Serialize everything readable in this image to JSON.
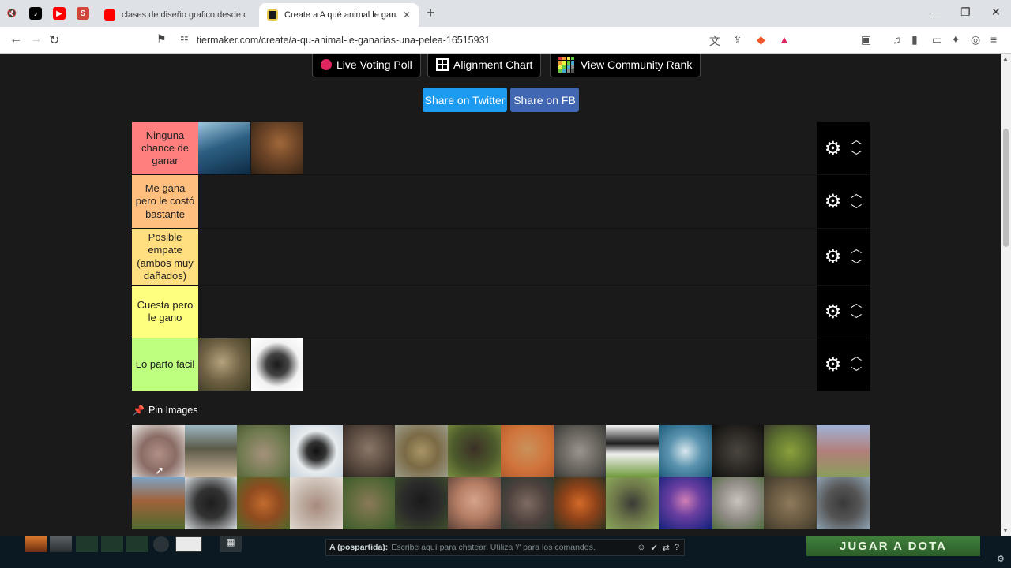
{
  "browser": {
    "tabs": [
      {
        "title": "clases de diseño grafico desde cero -",
        "favicon_color": "#ff0000"
      },
      {
        "title": "Create a A qué animal le ganarías",
        "favicon_color": "#1a1a1a",
        "active": true
      }
    ],
    "pinned_tabs": [
      {
        "icon": "mute-icon",
        "color": "#555555"
      },
      {
        "icon": "tiktok-icon",
        "color": "#000000"
      },
      {
        "icon": "youtube-icon",
        "color": "#ff0000"
      },
      {
        "icon": "s-icon",
        "color": "#d0443a"
      }
    ],
    "url": "tiermaker.com/create/a-qu-animal-le-ganarias-una-pelea-16515931",
    "new_tab_symbol": "+",
    "close_symbol": "✕"
  },
  "top_buttons": {
    "voting": "Live Voting Poll",
    "alignment": "Alignment Chart",
    "community": "View Community Rank"
  },
  "share": {
    "twitter": "Share on Twitter",
    "fb": "Share on FB",
    "twitter_color": "#1d9bf0",
    "fb_color": "#4267b2"
  },
  "tiers": [
    {
      "label": "Ninguna chance de ganar",
      "color": "#ff7f7f",
      "items": [
        "whale",
        "grizzly bear"
      ]
    },
    {
      "label": "Me gana pero le costó bastante",
      "color": "#ffbf7f",
      "items": []
    },
    {
      "label": "Posible empate (ambos muy dañados)",
      "color": "#ffdf7f",
      "items": []
    },
    {
      "label": "Cuesta pero le gano",
      "color": "#ffff7f",
      "items": []
    },
    {
      "label": "Lo parto facil",
      "color": "#bfff7f",
      "items": [
        "sloth",
        "scorpion"
      ]
    }
  ],
  "pin_images": "Pin Images",
  "pool": [
    "walrus",
    "ostrich",
    "kangaroo",
    "penguin",
    "elephant",
    "python",
    "buffalo",
    "meerkat",
    "sheep",
    "cow",
    "shark",
    "crocodile",
    "chameleon",
    "ostrich",
    "deer",
    "raven",
    "squirrel",
    "armadillo",
    "tortoise",
    "gorilla",
    "pitbull",
    "hippo",
    "fox",
    "anteater",
    "octopus",
    "koala",
    "hyena",
    "rhino"
  ],
  "overlay": {
    "chat_prefix": "A (pospartida):",
    "chat_hint": "Escribe aquí para chatear. Utiliza '/' para los comandos.",
    "play_button": "JUGAR A DOTA"
  }
}
